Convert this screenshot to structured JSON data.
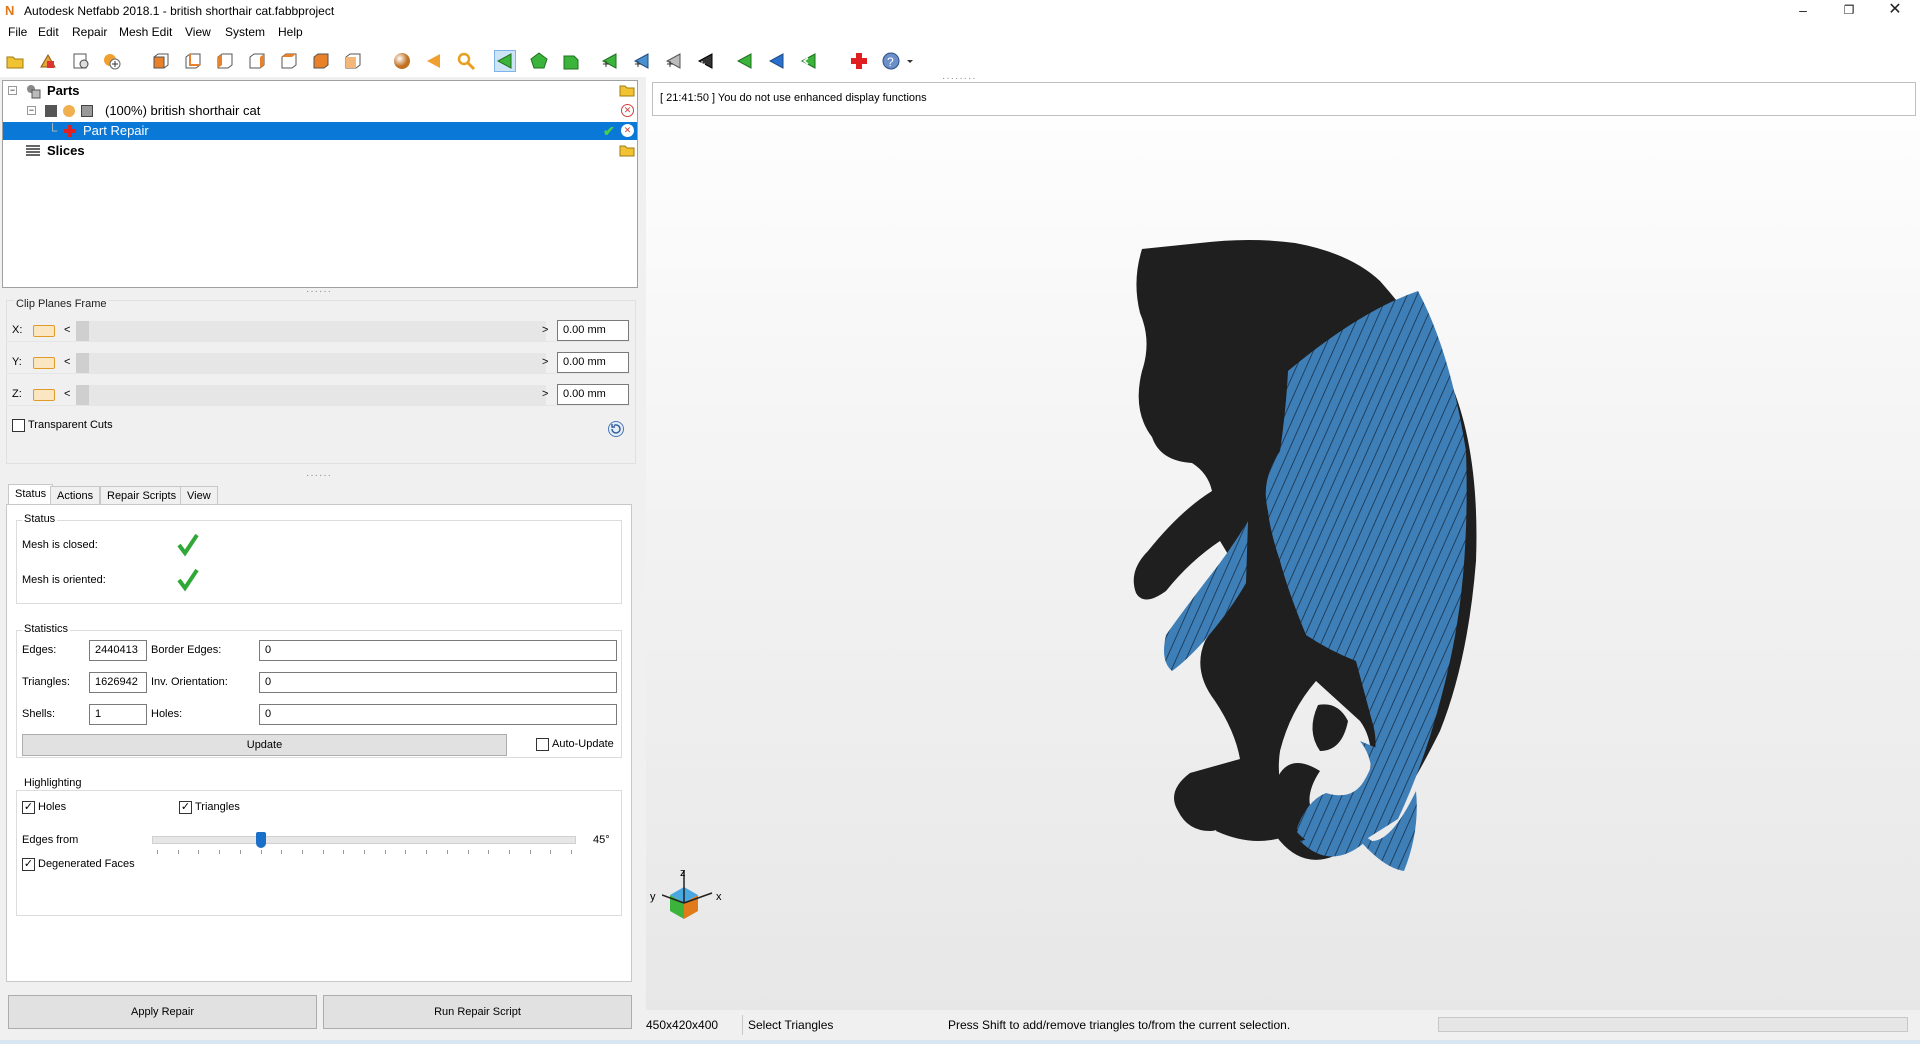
{
  "window": {
    "title": "Autodesk Netfabb 2018.1 - british shorthair cat.fabbproject",
    "logo_letter": "N"
  },
  "menu": [
    "File",
    "Edit",
    "Repair",
    "Mesh Edit",
    "View",
    "System",
    "Help"
  ],
  "tree": {
    "parts_label": "Parts",
    "part_label": "(100%) british shorthair cat",
    "repair_label": "Part Repair",
    "slices_label": "Slices"
  },
  "clip_planes": {
    "title": "Clip Planes Frame",
    "axes": [
      {
        "label": "X:",
        "value": "0.00 mm"
      },
      {
        "label": "Y:",
        "value": "0.00 mm"
      },
      {
        "label": "Z:",
        "value": "0.00 mm"
      }
    ],
    "transparent_cuts": "Transparent Cuts"
  },
  "tabs": [
    "Status",
    "Actions",
    "Repair Scripts",
    "View"
  ],
  "status": {
    "title": "Status",
    "closed_label": "Mesh is closed:",
    "oriented_label": "Mesh is oriented:"
  },
  "statistics": {
    "title": "Statistics",
    "edges_label": "Edges:",
    "edges": "2440413",
    "border_label": "Border Edges:",
    "border": "0",
    "triangles_label": "Triangles:",
    "triangles": "1626942",
    "inv_label": "Inv. Orientation:",
    "inv": "0",
    "shells_label": "Shells:",
    "shells": "1",
    "holes_label": "Holes:",
    "holes": "0",
    "update_button": "Update",
    "auto_update": "Auto-Update"
  },
  "highlighting": {
    "title": "Highlighting",
    "holes": "Holes",
    "triangles": "Triangles",
    "edges_from": "Edges from",
    "edges_value": "45°",
    "slider_fraction": 0.25,
    "degenerated": "Degenerated Faces"
  },
  "buttons": {
    "apply": "Apply Repair",
    "run_script": "Run Repair Script"
  },
  "console_message": "[ 21:41:50 ] You do not use enhanced display functions",
  "axis_labels": {
    "z": "z",
    "y": "y",
    "x": "x"
  },
  "statusbar": {
    "size": "450x420x400",
    "mode": "Select Triangles",
    "hint": "Press Shift to add/remove triangles to/from the current selection."
  },
  "colors": {
    "selection": "#0a78d7",
    "mesh_blue": "#3f7fb8",
    "mesh_dark": "#1f1f1f",
    "check_green": "#2fa836"
  }
}
